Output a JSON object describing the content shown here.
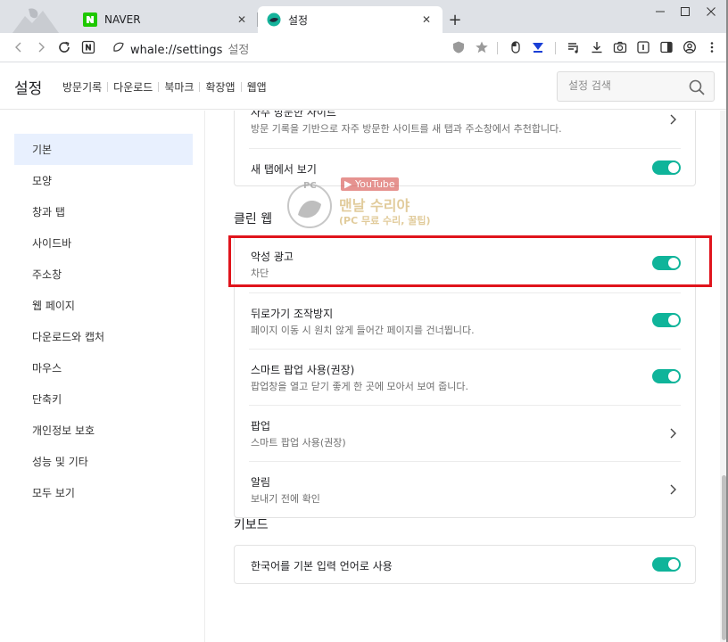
{
  "tabs": [
    {
      "title": "NAVER",
      "favicon_letter": "N",
      "favicon_color": "#1ec800",
      "active": false
    },
    {
      "title": "설정",
      "active": true
    }
  ],
  "address_bar": {
    "url": "whale://settings",
    "suffix": "설정"
  },
  "header": {
    "title": "설정",
    "nav": [
      "방문기록",
      "다운로드",
      "북마크",
      "확장앱",
      "웹앱"
    ],
    "search_placeholder": "설정 검색"
  },
  "sidebar": {
    "items": [
      "기본",
      "모양",
      "창과 탭",
      "사이드바",
      "주소창",
      "웹 페이지",
      "다운로드와 캡처",
      "마우스",
      "단축키",
      "개인정보 보호",
      "성능 및 기타",
      "모두 보기"
    ],
    "selected": "기본"
  },
  "top_card": {
    "rows": [
      {
        "title": "자주 방문한 사이트",
        "subtitle": "방문 기록을 기반으로 자주 방문한 사이트를 새 탭과 주소창에서 추천합니다.",
        "control": "chevron"
      },
      {
        "title": "새 탭에서 보기",
        "control": "toggle",
        "on": true
      }
    ]
  },
  "clean_web": {
    "title": "클린 웹",
    "rows": [
      {
        "title": "악성 광고",
        "subtitle": "차단",
        "control": "toggle",
        "on": true
      },
      {
        "title": "뒤로가기 조작방지",
        "subtitle": "페이지 이동 시 원치 않게 들어간 페이지를 건너뜁니다.",
        "control": "toggle",
        "on": true
      },
      {
        "title": "스마트 팝업 사용(권장)",
        "subtitle": "팝업창을 열고 닫기 좋게 한 곳에 모아서 보여 줍니다.",
        "control": "toggle",
        "on": true
      },
      {
        "title": "팝업",
        "subtitle": "스마트 팝업 사용(권장)",
        "control": "chevron"
      },
      {
        "title": "알림",
        "subtitle": "보내기 전에 확인",
        "control": "chevron"
      }
    ]
  },
  "keyboard": {
    "title": "키보드",
    "rows": [
      {
        "title": "한국어를 기본 입력 언어로 사용",
        "control": "toggle",
        "on": true
      }
    ]
  },
  "watermark": {
    "badge": "PC",
    "youtube": "▶ YouTube",
    "name": "맨날 수리야",
    "subtitle": "(PC 무료 수리, 꿀팁)"
  },
  "colors": {
    "accent_toggle": "#0fb49a",
    "highlight": "#e0141c",
    "selected_bg": "#e8f0fe"
  }
}
